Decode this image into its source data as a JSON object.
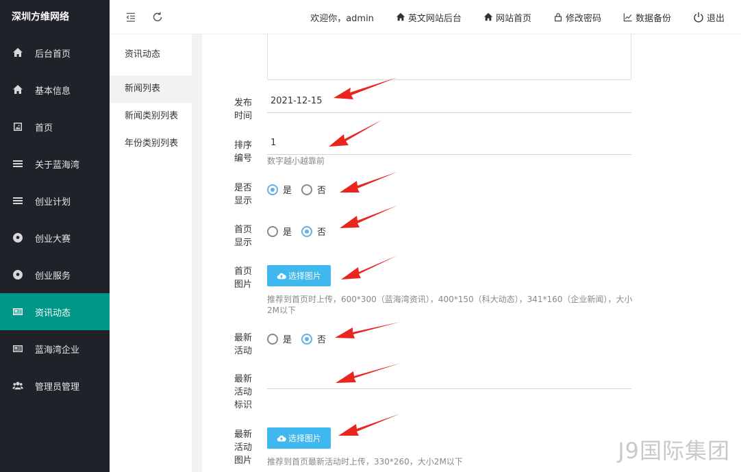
{
  "app": {
    "brand": "深圳方维网络"
  },
  "sidebar": {
    "items": [
      {
        "label": "后台首页",
        "icon": "home-icon"
      },
      {
        "label": "基本信息",
        "icon": "home-icon"
      },
      {
        "label": "首页",
        "icon": "image-icon"
      },
      {
        "label": "关于蓝海湾",
        "icon": "list-icon"
      },
      {
        "label": "创业计划",
        "icon": "list-icon"
      },
      {
        "label": "创业大赛",
        "icon": "soccer-ball-icon"
      },
      {
        "label": "创业服务",
        "icon": "soccer-ball-icon"
      },
      {
        "label": "资讯动态",
        "icon": "newspaper-icon",
        "active": true
      },
      {
        "label": "蓝海湾企业",
        "icon": "newspaper-icon"
      },
      {
        "label": "管理员管理",
        "icon": "users-icon"
      }
    ]
  },
  "header": {
    "welcome": "欢迎你，admin",
    "links": [
      {
        "label": "英文网站后台",
        "icon": "home-icon"
      },
      {
        "label": "网站首页",
        "icon": "home-icon"
      },
      {
        "label": "修改密码",
        "icon": "lock-icon"
      },
      {
        "label": "数据备份",
        "icon": "chart-icon"
      },
      {
        "label": "退出",
        "icon": "power-icon"
      }
    ]
  },
  "submenu": {
    "title": "资讯动态",
    "items": [
      {
        "label": "新闻列表",
        "active": true
      },
      {
        "label": "新闻类别列表"
      },
      {
        "label": "年份类别列表"
      }
    ]
  },
  "form": {
    "publish_time": {
      "label_1": "发布",
      "label_2": "时间",
      "value": "2021-12-15"
    },
    "sort_no": {
      "label_1": "排序",
      "label_2": "编号",
      "value": "1",
      "hint": "数字越小越靠前"
    },
    "is_show": {
      "label_1": "是否",
      "label_2": "显示",
      "yes": "是",
      "no": "否",
      "selected": "是"
    },
    "home_show": {
      "label_1": "首页",
      "label_2": "显示",
      "yes": "是",
      "no": "否",
      "selected": "否"
    },
    "home_image": {
      "label_1": "首页",
      "label_2": "图片",
      "button": "选择图片",
      "hint": "推荐到首页时上传，600*300（蓝海湾资讯），400*150（科大动态），341*160（企业新闻），大小2M以下"
    },
    "latest_activity": {
      "label_1": "最新",
      "label_2": "活动",
      "yes": "是",
      "no": "否",
      "selected": "否"
    },
    "activity_tag": {
      "label_1": "最新",
      "label_2": "活动",
      "label_3": "标识",
      "value": ""
    },
    "activity_image": {
      "label_1": "最新",
      "label_2": "活动",
      "label_3": "图片",
      "button": "选择图片",
      "hint": "推荐到首页最新活动时上传，330*260，大小2M以下"
    }
  },
  "watermark": "J9国际集团",
  "colors": {
    "sidebar_bg": "#20222a",
    "active": "#009688",
    "button": "#3fb8f0",
    "radio_on": "#5fb0e6",
    "arrow": "#e8251f"
  }
}
